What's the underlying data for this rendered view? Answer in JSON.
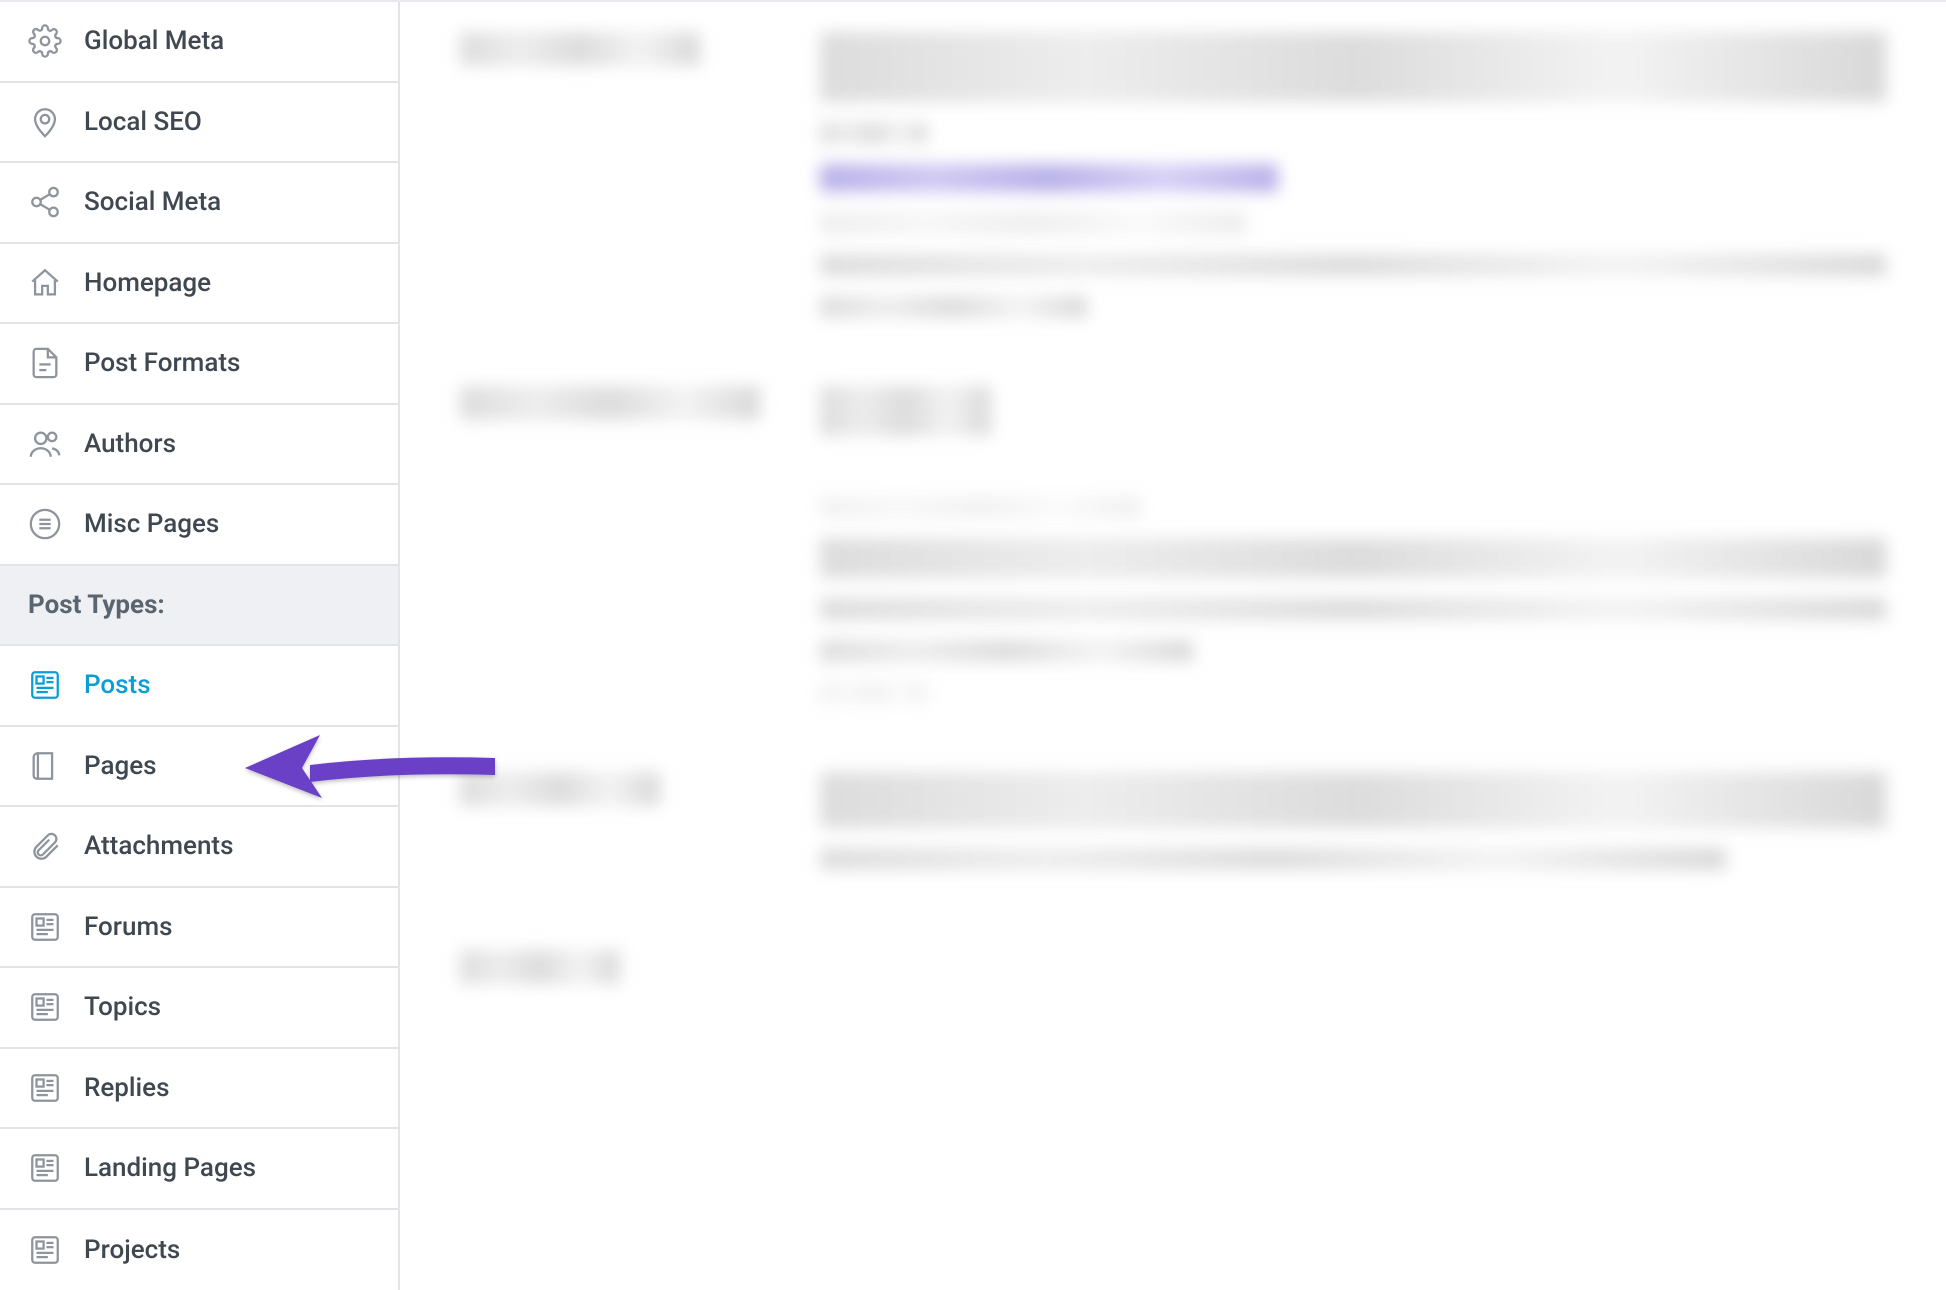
{
  "sidebar": {
    "items_top": [
      {
        "id": "global-meta",
        "icon": "gear-icon",
        "label": "Global Meta"
      },
      {
        "id": "local-seo",
        "icon": "pin-icon",
        "label": "Local SEO"
      },
      {
        "id": "social-meta",
        "icon": "share-icon",
        "label": "Social Meta"
      },
      {
        "id": "homepage",
        "icon": "house-icon",
        "label": "Homepage"
      },
      {
        "id": "post-formats",
        "icon": "document-icon",
        "label": "Post Formats"
      },
      {
        "id": "authors",
        "icon": "people-icon",
        "label": "Authors"
      },
      {
        "id": "misc-pages",
        "icon": "list-circle-icon",
        "label": "Misc Pages"
      }
    ],
    "heading_post_types": "Post Types:",
    "items_post_types": [
      {
        "id": "posts",
        "icon": "post-icon",
        "label": "Posts",
        "active": true
      },
      {
        "id": "pages",
        "icon": "page-icon",
        "label": "Pages"
      },
      {
        "id": "attachments",
        "icon": "paperclip-icon",
        "label": "Attachments"
      },
      {
        "id": "forums",
        "icon": "post-icon",
        "label": "Forums"
      },
      {
        "id": "topics",
        "icon": "post-icon",
        "label": "Topics"
      },
      {
        "id": "replies",
        "icon": "post-icon",
        "label": "Replies"
      },
      {
        "id": "landing-pages",
        "icon": "post-icon",
        "label": "Landing Pages"
      },
      {
        "id": "projects",
        "icon": "post-icon",
        "label": "Projects"
      }
    ]
  },
  "annotation": {
    "target": "pages",
    "color": "#6b3fc6"
  }
}
